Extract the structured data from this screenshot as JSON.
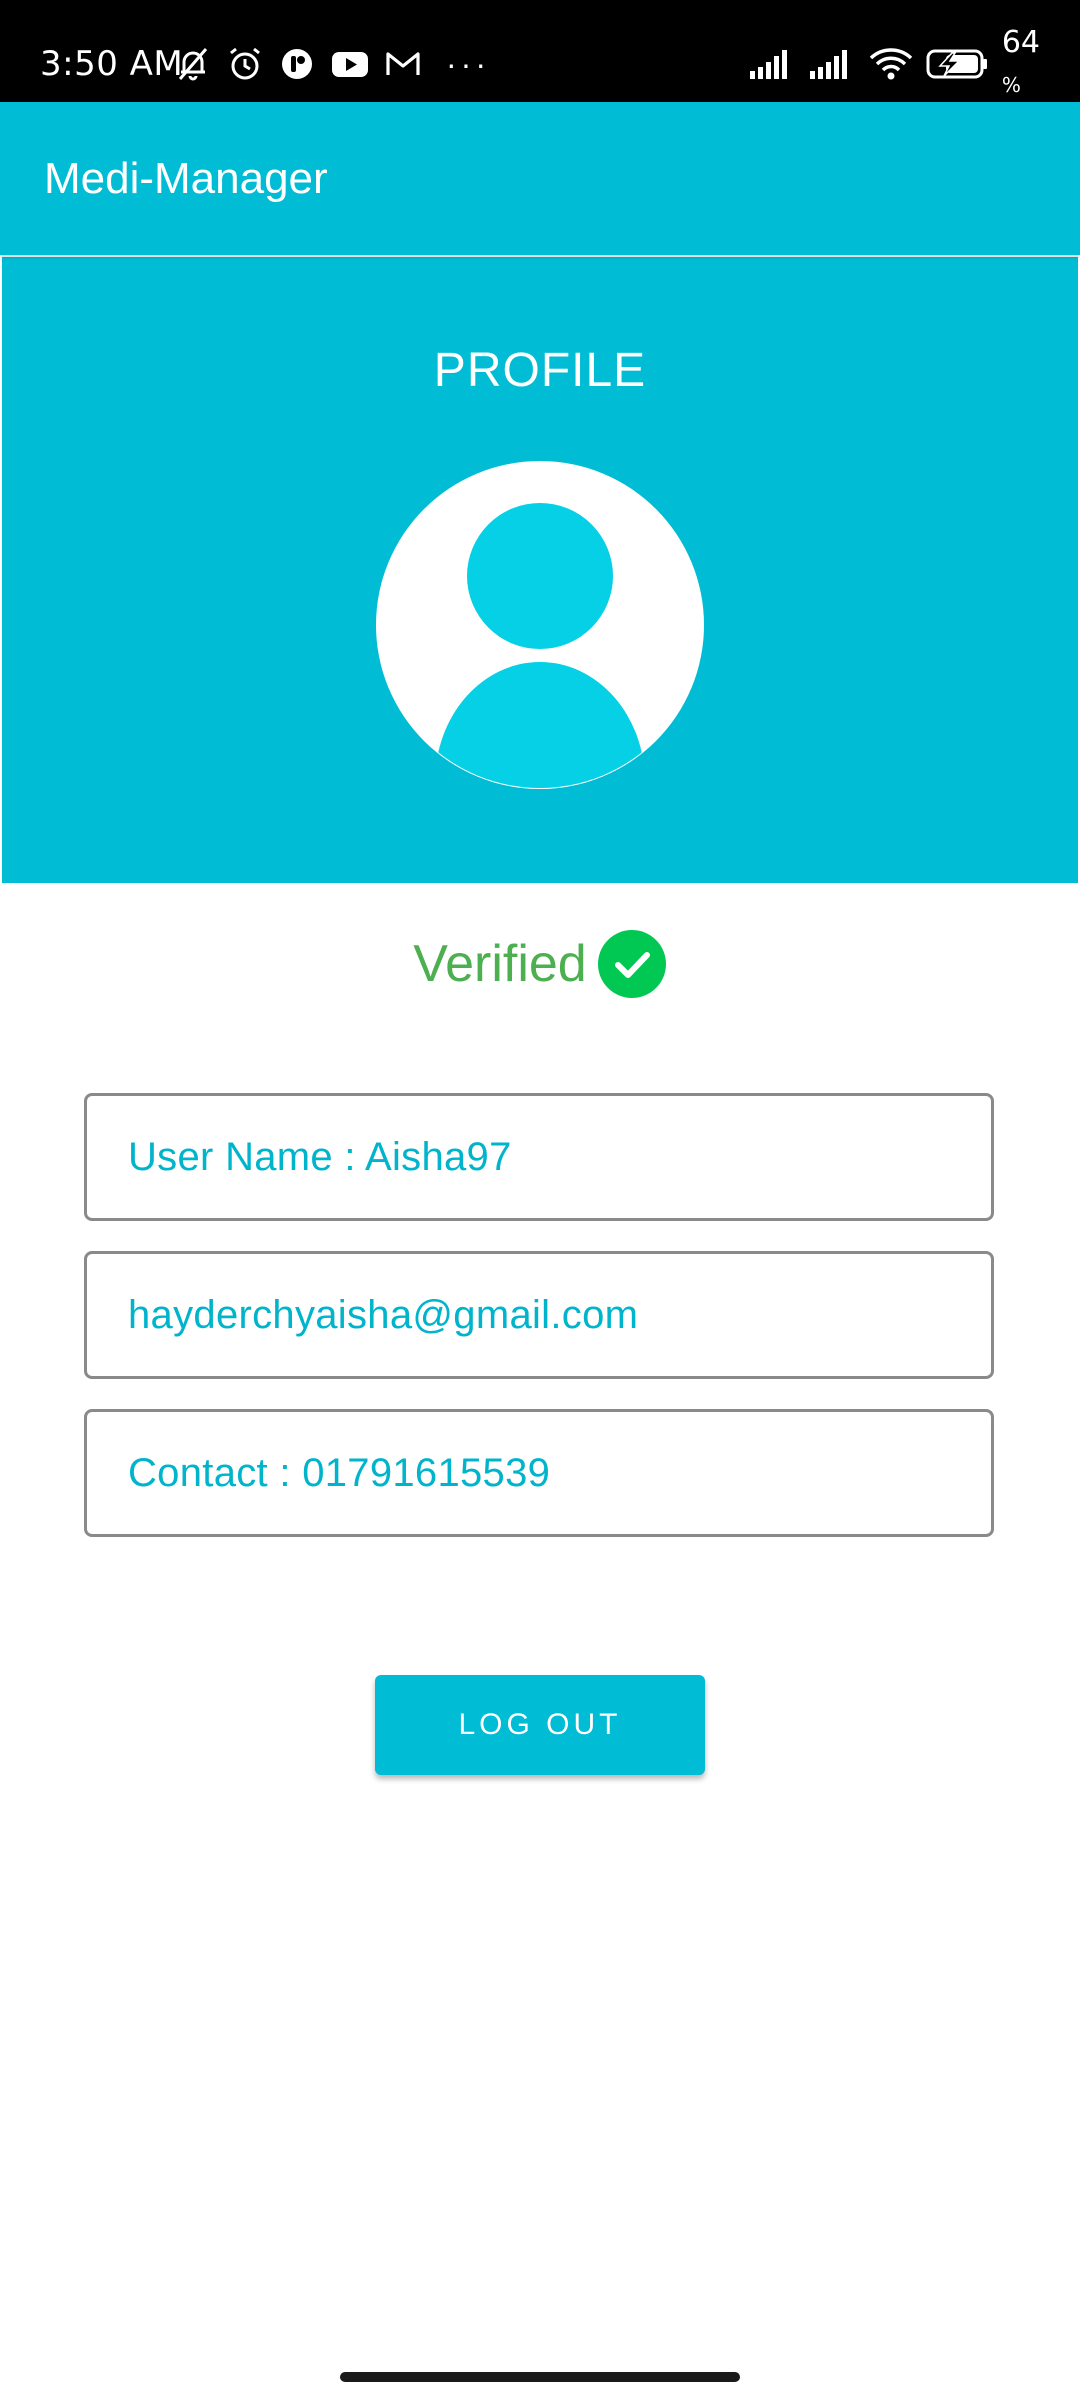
{
  "status_bar": {
    "time": "3:50 AM",
    "battery_percent": "64",
    "battery_unit": "%",
    "more_indicator": "···",
    "icons": [
      "mute-bell-icon",
      "alarm-icon",
      "app-notification-icon",
      "youtube-icon",
      "gmail-icon",
      "signal-icon",
      "signal-icon",
      "wifi-icon",
      "battery-charging-icon"
    ]
  },
  "app_bar": {
    "title": "Medi-Manager"
  },
  "profile": {
    "heading": "PROFILE",
    "avatar_icon": "person-icon",
    "verified_label": "Verified",
    "verified_icon": "check-circle-icon"
  },
  "fields": {
    "username": "User Name : Aisha97",
    "email": "hayderchyaisha@gmail.com",
    "contact": "Contact : 01791615539"
  },
  "actions": {
    "logout_label": "LOG OUT"
  },
  "colors": {
    "primary": "#00bcd4",
    "field_text": "#00b4cc",
    "verified_text": "#4caf50",
    "verified_badge": "#00c853",
    "avatar_accent": "#05d0e6"
  }
}
